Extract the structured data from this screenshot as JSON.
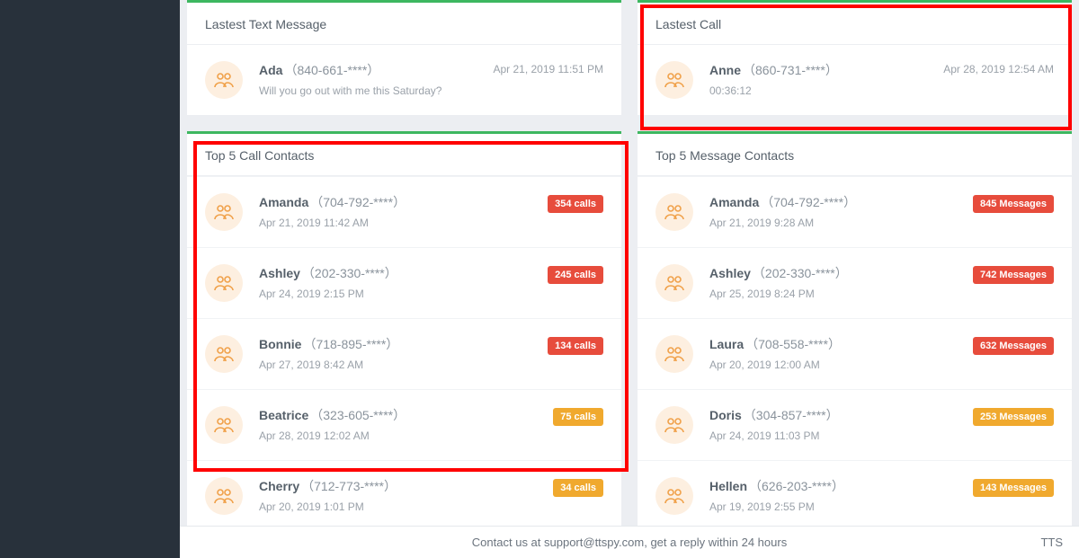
{
  "latest_text": {
    "title": "Lastest Text Message",
    "name": "Ada",
    "phone": "（840-661-****）",
    "sub": "Will you go out with me this Saturday?",
    "right": "Apr 21, 2019 11:51 PM"
  },
  "latest_call": {
    "title": "Lastest Call",
    "name": "Anne",
    "phone": "（860-731-****）",
    "sub": "00:36:12",
    "right": "Apr 28, 2019 12:54 AM"
  },
  "top_calls_title": "Top 5 Call Contacts",
  "top_calls": [
    {
      "name": "Amanda",
      "phone": "（704-792-****）",
      "sub": "Apr 21, 2019 11:42 AM",
      "badge": "354 calls",
      "cls": "badge-red"
    },
    {
      "name": "Ashley",
      "phone": "（202-330-****）",
      "sub": "Apr 24, 2019 2:15 PM",
      "badge": "245 calls",
      "cls": "badge-red"
    },
    {
      "name": "Bonnie",
      "phone": "（718-895-****）",
      "sub": "Apr 27, 2019 8:42 AM",
      "badge": "134 calls",
      "cls": "badge-red"
    },
    {
      "name": "Beatrice",
      "phone": "（323-605-****）",
      "sub": "Apr 28, 2019 12:02 AM",
      "badge": "75 calls",
      "cls": "badge-orange"
    },
    {
      "name": "Cherry",
      "phone": "（712-773-****）",
      "sub": "Apr 20, 2019 1:01 PM",
      "badge": "34 calls",
      "cls": "badge-orange"
    }
  ],
  "top_msgs_title": "Top 5 Message Contacts",
  "top_msgs": [
    {
      "name": "Amanda",
      "phone": "（704-792-****）",
      "sub": "Apr 21, 2019 9:28 AM",
      "badge": "845 Messages",
      "cls": "badge-red"
    },
    {
      "name": "Ashley",
      "phone": "（202-330-****）",
      "sub": "Apr 25, 2019 8:24 PM",
      "badge": "742 Messages",
      "cls": "badge-red"
    },
    {
      "name": "Laura",
      "phone": "（708-558-****）",
      "sub": "Apr 20, 2019 12:00 AM",
      "badge": "632 Messages",
      "cls": "badge-red"
    },
    {
      "name": "Doris",
      "phone": "（304-857-****）",
      "sub": "Apr 24, 2019 11:03 PM",
      "badge": "253 Messages",
      "cls": "badge-orange"
    },
    {
      "name": "Hellen",
      "phone": "（626-203-****）",
      "sub": "Apr 19, 2019 2:55 PM",
      "badge": "143 Messages",
      "cls": "badge-orange"
    }
  ],
  "footer_text": "Contact us at support@ttspy.com, get a reply within 24 hours",
  "footer_right": "TTS"
}
